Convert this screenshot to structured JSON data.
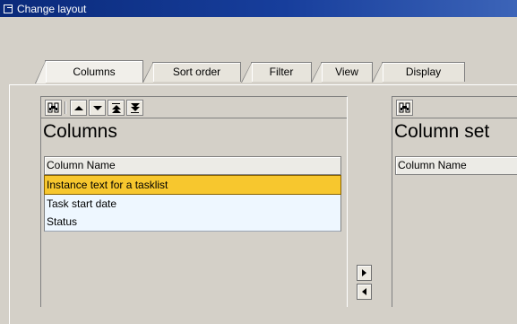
{
  "window": {
    "title": "Change layout"
  },
  "tabs": [
    {
      "label": "Columns",
      "active": true
    },
    {
      "label": "Sort order",
      "active": false
    },
    {
      "label": "Filter",
      "active": false
    },
    {
      "label": "View",
      "active": false
    },
    {
      "label": "Display",
      "active": false
    }
  ],
  "left_panel": {
    "title": "Columns",
    "column_header": "Column Name",
    "rows": [
      {
        "label": "Instance text for a tasklist",
        "selected": true
      },
      {
        "label": "Task start date",
        "selected": false
      },
      {
        "label": "Status",
        "selected": false
      }
    ],
    "toolbar_icons": [
      "find-icon",
      "move-up-icon",
      "move-down-icon",
      "move-top-icon",
      "move-bottom-icon"
    ]
  },
  "right_panel": {
    "title": "Column set",
    "column_header": "Column Name",
    "toolbar_icons": [
      "find-icon"
    ]
  },
  "transfer": {
    "icons": [
      "move-right-icon",
      "move-left-icon"
    ]
  },
  "colors": {
    "title_bar": "#0a2a7a",
    "selected_row": "#f7c72e",
    "list_row": "#eef7ff",
    "window_bg": "#d4d0c8"
  }
}
